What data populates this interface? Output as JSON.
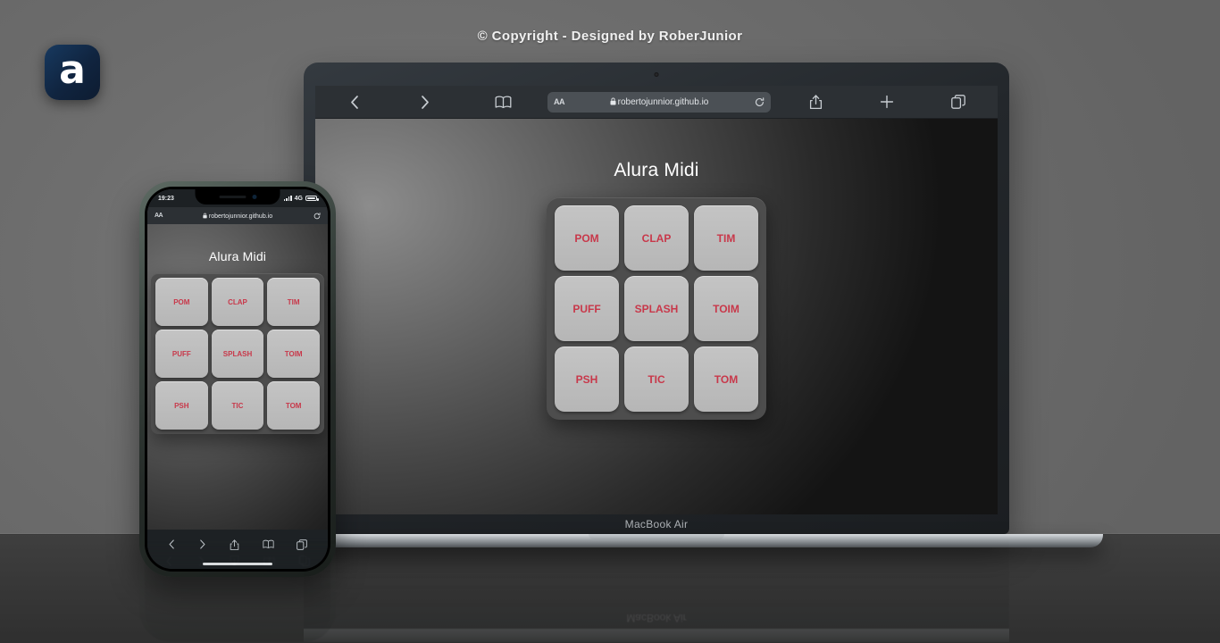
{
  "page": {
    "copyright": "© Copyright - Designed by RoberJunior",
    "background_color": "#6e6e6e",
    "floor_color": "#3a3a3a"
  },
  "logo": {
    "name": "alura-logo",
    "glyph": "a",
    "background_color": "#10243f",
    "glyph_color": "#ffffff"
  },
  "laptop": {
    "device_label": "MacBook Air",
    "browser": {
      "back_icon": "chevron-left-icon",
      "forward_icon": "chevron-right-icon",
      "bookmarks_icon": "book-icon",
      "share_icon": "share-icon",
      "new_tab_icon": "plus-icon",
      "tabs_icon": "tabs-icon",
      "reload_icon": "reload-icon",
      "lock_icon": "lock-icon",
      "text_size_label": "AA",
      "url": "robertojunnior.github.io"
    },
    "app": {
      "title": "Alura Midi",
      "pads": [
        {
          "label": "POM"
        },
        {
          "label": "CLAP"
        },
        {
          "label": "TIM"
        },
        {
          "label": "PUFF"
        },
        {
          "label": "SPLASH"
        },
        {
          "label": "TOIM"
        },
        {
          "label": "PSH"
        },
        {
          "label": "TIC"
        },
        {
          "label": "TOM"
        }
      ],
      "pad_color": "#bcbcbc",
      "pad_text_color": "#c8384a",
      "board_color": "#4d4d4d",
      "title_color": "#ffffff"
    }
  },
  "phone": {
    "status": {
      "time": "19:23",
      "network": "4G",
      "signal_icon": "signal-bars-icon",
      "battery_icon": "battery-icon"
    },
    "browser": {
      "text_size_label": "AA",
      "lock_icon": "lock-icon",
      "url": "robertojunnior.github.io",
      "reload_icon": "reload-icon"
    },
    "toolbar": {
      "back_icon": "chevron-left-icon",
      "forward_icon": "chevron-right-icon",
      "share_icon": "share-icon",
      "bookmarks_icon": "book-icon",
      "tabs_icon": "tabs-icon"
    },
    "app": {
      "title": "Alura Midi",
      "pads": [
        {
          "label": "POM"
        },
        {
          "label": "CLAP"
        },
        {
          "label": "TIM"
        },
        {
          "label": "PUFF"
        },
        {
          "label": "SPLASH"
        },
        {
          "label": "TOIM"
        },
        {
          "label": "PSH"
        },
        {
          "label": "TIC"
        },
        {
          "label": "TOM"
        }
      ]
    }
  }
}
